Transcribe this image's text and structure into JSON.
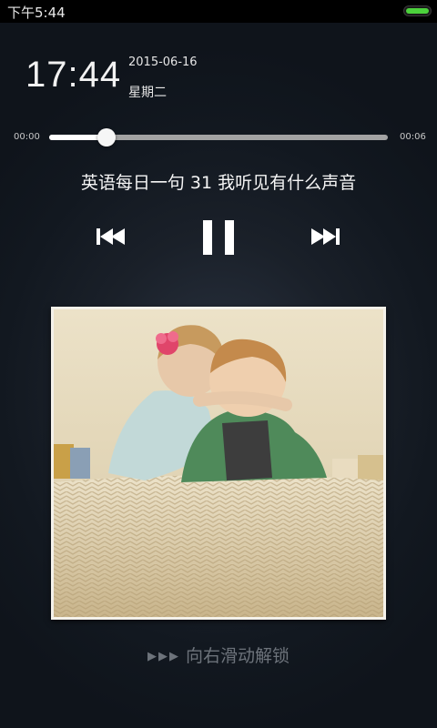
{
  "status_bar": {
    "time": "下午5:44",
    "battery_level": 1.0,
    "battery_color": "#4cd13c"
  },
  "lock_clock": {
    "time": "17:44",
    "date": "2015-06-16",
    "weekday": "星期二"
  },
  "player": {
    "elapsed": "00:00",
    "total": "00:06",
    "progress": 0.17,
    "title": "英语每日一句 31 我听见有什么声音",
    "controls": {
      "previous_icon": "skip-previous-icon",
      "pause_icon": "pause-icon",
      "next_icon": "skip-next-icon"
    },
    "album_art": "children-hugging-on-bed-photo"
  },
  "unlock": {
    "arrows": "▶▶▶",
    "label": "向右滑动解锁"
  }
}
